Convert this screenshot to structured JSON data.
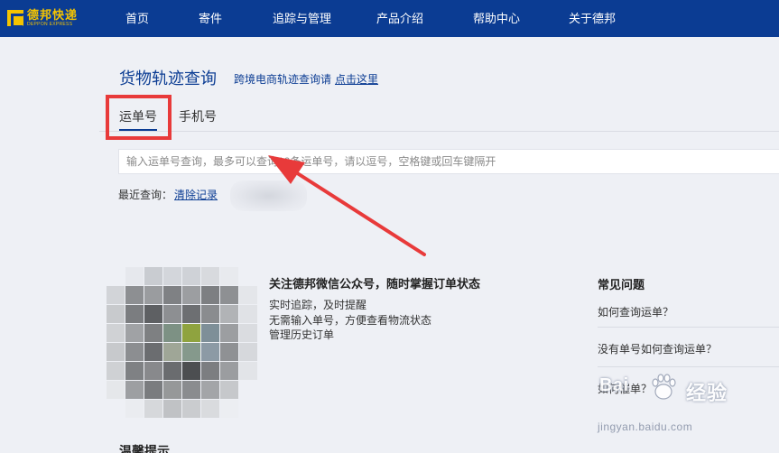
{
  "brand": {
    "logo_cn": "德邦快递",
    "logo_en": "DEPPON EXPRESS"
  },
  "nav": {
    "items": [
      {
        "label": "首页"
      },
      {
        "label": "寄件"
      },
      {
        "label": "追踪与管理"
      },
      {
        "label": "产品介绍"
      },
      {
        "label": "帮助中心"
      },
      {
        "label": "关于德邦"
      }
    ]
  },
  "tracking": {
    "title": "货物轨迹查询",
    "cross_border_prefix": "跨境电商轨迹查询请",
    "cross_border_link": "点击这里",
    "tabs": [
      {
        "label": "运单号",
        "active": true
      },
      {
        "label": "手机号",
        "active": false
      }
    ],
    "search_placeholder": "输入运单号查询，最多可以查询10条运单号，请以逗号，空格键或回车键隔开",
    "search_value": "",
    "recent_label": "最近查询：",
    "clear_label": "清除记录"
  },
  "wechat": {
    "title": "关注德邦微信公众号，随时掌握订单状态",
    "lines": [
      "实时追踪，及时提醒",
      "无需输入单号，方便查看物流状态",
      "管理历史订单"
    ]
  },
  "faq": {
    "title": "常见问题",
    "items": [
      "如何查询运单？",
      "没有单号如何查询运单？",
      "如何催单？"
    ]
  },
  "tips": {
    "title": "温馨提示"
  },
  "watermark": {
    "brand": "Bai",
    "brand2": "经验",
    "url": "jingyan.baidu.com"
  },
  "colors": {
    "nav_bg": "#0b3c93",
    "logo": "#f4c400",
    "annotation_red": "#e83a3a",
    "page_bg": "#eef0f5"
  },
  "icons": [
    "deppon-logo-icon",
    "annotation-arrow",
    "qr-code-icon",
    "baidu-paw-icon"
  ]
}
